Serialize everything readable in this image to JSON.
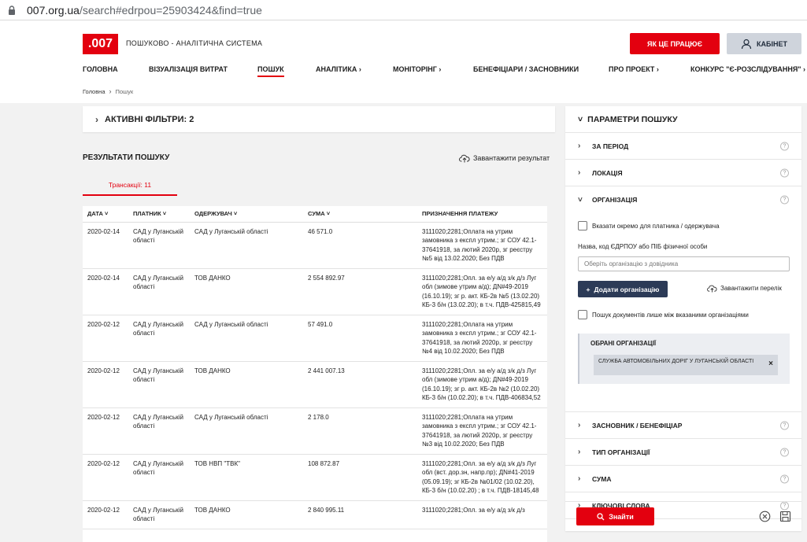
{
  "browser": {
    "url_domain": "007.org.ua",
    "url_path": "/search#edrpou=25903424&find=true"
  },
  "header": {
    "logo": ".007",
    "tagline": "ПОШУКОВО - АНАЛІТИЧНА СИСТЕМА",
    "how_it_works": "ЯК ЦЕ ПРАЦЮЄ",
    "cabinet": "КАБІНЕТ"
  },
  "nav": [
    "ГОЛОВНА",
    "ВІЗУАЛІЗАЦІЯ ВИТРАТ",
    "ПОШУК",
    "АНАЛІТИКА ›",
    "МОНІТОРІНГ ›",
    "БЕНЕФІЦІАРИ / ЗАСНОВНИКИ",
    "ПРО ПРОЕКТ ›",
    "КОНКУРС \"Є-РОЗСЛІДУВАННЯ\" ›"
  ],
  "breadcrumb": {
    "home": "Головна",
    "current": "Пошук"
  },
  "filters": {
    "label": "АКТИВНІ ФІЛЬТРИ: 2"
  },
  "results": {
    "title": "РЕЗУЛЬТАТИ ПОШУКУ",
    "download": "Завантажити результат",
    "tab": "Трансакції: 11",
    "columns": [
      "ДАТА",
      "ПЛАТНИК",
      "ОДЕРЖУВАЧ",
      "СУМА",
      "ПРИЗНАЧЕННЯ ПЛАТЕЖУ"
    ],
    "rows": [
      {
        "date": "2020-02-14",
        "payer": "САД у Луганській області",
        "recipient": "САД у Луганській області",
        "sum": "46 571.0",
        "purpose": "3111020;2281;Оплата на утрим замовника з експл утрим.; зг СОУ 42.1-37641918, за лютий 2020р, зг реєстру №5 від 13.02.2020; Без ПДВ"
      },
      {
        "date": "2020-02-14",
        "payer": "САД у Луганській області",
        "recipient": "ТОВ ДАНКО",
        "sum": "2 554 892.97",
        "purpose": "3111020;2281;Опл. за е/у а/д з/к д/з Луг обл (зимове утрим а/д); ДN#49-2019 (16.10.19); зг р. акт. КБ-2в №5 (13.02.20) КБ-3 б/н (13.02.20); в т.ч. ПДВ-425815,49"
      },
      {
        "date": "2020-02-12",
        "payer": "САД у Луганській області",
        "recipient": "САД у Луганській області",
        "sum": "57 491.0",
        "purpose": "3111020;2281;Оплата на утрим замовника з експл утрим.; зг СОУ 42.1-37641918, за лютий 2020р, зг реєстру №4 від 10.02.2020; Без ПДВ"
      },
      {
        "date": "2020-02-12",
        "payer": "САД у Луганській області",
        "recipient": "ТОВ ДАНКО",
        "sum": "2 441 007.13",
        "purpose": "3111020;2281;Опл. за е/у а/д з/к д/з Луг обл (зимове утрим а/д); ДN#49-2019 (16.10.19); зг р. акт. КБ-2в №2 (10.02.20) КБ-3 б/н (10.02.20); в т.ч. ПДВ-406834,52"
      },
      {
        "date": "2020-02-12",
        "payer": "САД у Луганській області",
        "recipient": "САД у Луганській області",
        "sum": "2 178.0",
        "purpose": "3111020;2281;Оплата на утрим замовника з експл утрим.; зг СОУ 42.1-37641918, за лютий 2020р, зг реєстру №3 від 10.02.2020; Без ПДВ"
      },
      {
        "date": "2020-02-12",
        "payer": "САД у Луганській області",
        "recipient": "ТОВ НВП \"ТВК\"",
        "sum": "108 872.87",
        "purpose": "3111020;2281;Опл. за е/у а/д з/к д/з Луг обл (вст. дор.зн, напр.пр); ДN#41-2019 (05.09.19); зг КБ-2в №01/02 (10.02.20), КБ-3 б/н (10.02.20) ; в т.ч. ПДВ-18145,48"
      },
      {
        "date": "2020-02-12",
        "payer": "САД у Луганській області",
        "recipient": "ТОВ ДАНКО",
        "sum": "2 840 995.11",
        "purpose": "3111020;2281;Опл. за е/у а/д з/к д/з"
      }
    ]
  },
  "params": {
    "title": "ПАРАМЕТРИ ПОШУКУ",
    "sections": {
      "period": "ЗА ПЕРІОД",
      "location": "ЛОКАЦІЯ",
      "organization": "ОРГАНІЗАЦІЯ",
      "founder": "ЗАСНОВНИК / БЕНЕФІЦІАР",
      "org_type": "ТИП ОРГАНІЗАЦІЇ",
      "sum": "СУМА",
      "keywords": "КЛЮЧОВІ СЛОВА"
    },
    "separately_label": "Вказати окремо для платника / одержувача",
    "name_label": "Назва, код ЄДРПОУ або ПІБ фізичної особи",
    "org_placeholder": "Оберіть організацію з довідника",
    "add_org": "Додати організацію",
    "download_list": "Завантажити перелік",
    "only_between_label": "Пошук документів лише між вказаними організаціями",
    "chosen_title": "ОБРАНІ ОРГАНІЗАЦІЇ",
    "chosen_org": "СЛУЖБА АВТОМОБІЛЬНИХ ДОРІГ У ЛУГАНСЬКІЙ ОБЛАСТІ",
    "find": "Знайти",
    "help": "?"
  },
  "colors": {
    "accent": "#e3000f",
    "navy": "#2c3b57"
  }
}
